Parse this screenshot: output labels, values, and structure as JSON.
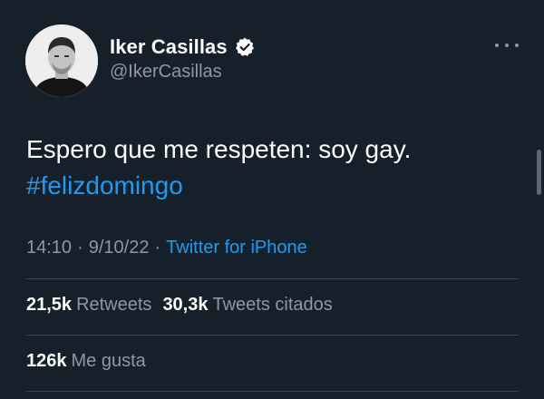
{
  "author": {
    "display_name": "Iker Casillas",
    "handle": "@IkerCasillas",
    "verified": true,
    "avatar_icon": "avatar-photo"
  },
  "tweet": {
    "text": "Espero que me respeten: soy gay.",
    "hashtag": "#felizdomingo",
    "time": "14:10",
    "separator": "·",
    "date": "9/10/22",
    "source": "Twitter for iPhone"
  },
  "stats": {
    "retweets_count": "21,5k",
    "retweets_label": "Retweets",
    "quotes_count": "30,3k",
    "quotes_label": "Tweets citados",
    "likes_count": "126k",
    "likes_label": "Me gusta"
  },
  "colors": {
    "background": "#15202b",
    "text": "#ffffff",
    "secondary": "#8b98a5",
    "link": "#1d9bf0",
    "divider": "#38444d"
  },
  "icons": {
    "verified": "verified-badge-icon",
    "more": "more-options-icon"
  }
}
